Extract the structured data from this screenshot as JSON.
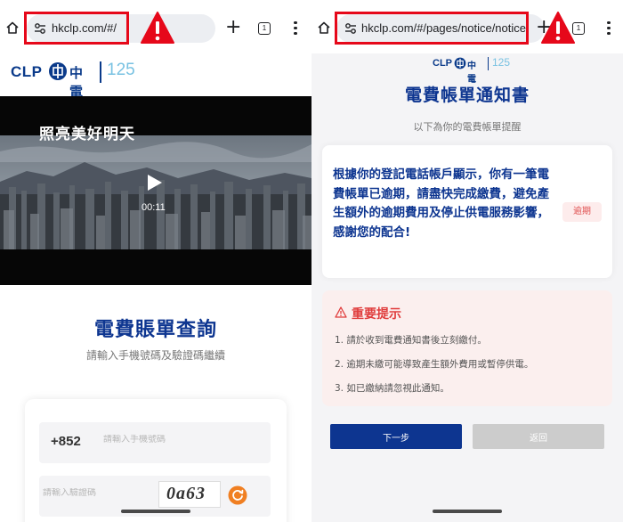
{
  "left": {
    "address_bar": {
      "url": "hkclp.com/#/",
      "tab_count": "1"
    },
    "logo": {
      "en": "CLP",
      "cn": "中電",
      "anniversary": "125"
    },
    "video": {
      "title": "照亮美好明天",
      "duration": "00:11"
    },
    "query": {
      "title": "電費賬單查詢",
      "subtitle": "請輸入手機號碼及驗證碼繼續",
      "country_code": "+852",
      "phone_placeholder": "請輸入手機號碼",
      "captcha_placeholder": "請輸入驗證碼",
      "captcha_text": "0a63"
    }
  },
  "right": {
    "address_bar": {
      "url": "hkclp.com/#/pages/notice/notice",
      "tab_count": "1"
    },
    "logo": {
      "en": "CLP",
      "cn": "中電",
      "anniversary": "125"
    },
    "title": "電費帳單通知書",
    "subtitle": "以下為你的電費帳單提醒",
    "notice_text": "根據你的登記電話帳戶顯示，你有一筆電費帳單已逾期，請盡快完成繳費，避免產生額外的逾期費用及停止供電服務影響，感謝您的配合!",
    "status_badge": "逾期",
    "tips": {
      "title": "重要提示",
      "items": [
        "1. 請於收到電費通知書後立刻繳付。",
        "2. 逾期未繳可能導致產生額外費用或暫停供電。",
        "3. 如已繳納請忽視此通知。"
      ]
    },
    "buttons": {
      "next": "下一步",
      "back": "返回"
    }
  },
  "colors": {
    "brand_blue": "#0d3590",
    "alert_red": "#e6081a",
    "overdue_red": "#e05050",
    "tips_bg": "#fbefee",
    "disabled_gray": "#cccccc"
  }
}
